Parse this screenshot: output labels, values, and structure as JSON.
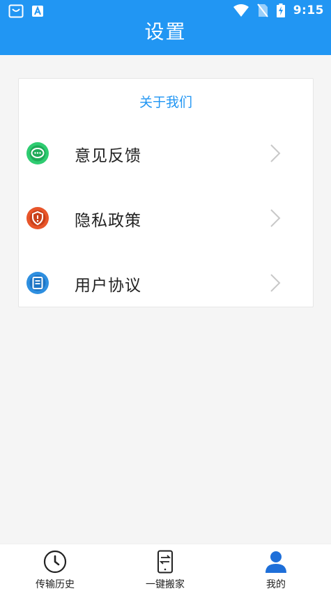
{
  "status_bar": {
    "time": "9:15",
    "left_icons": [
      "shopping-bag-icon",
      "font-a-icon"
    ],
    "right_icons": [
      "wifi-icon",
      "no-sim-icon",
      "battery-charging-icon"
    ]
  },
  "header": {
    "title": "设置"
  },
  "settings": {
    "section_title": "关于我们",
    "items": [
      {
        "label": "意见反馈",
        "icon": "feedback-icon",
        "icon_color": "#2ecc71"
      },
      {
        "label": "隐私政策",
        "icon": "privacy-shield-icon",
        "icon_color": "#e8552a"
      },
      {
        "label": "用户协议",
        "icon": "agreement-icon",
        "icon_color": "#2e8fe0"
      }
    ]
  },
  "bottom_nav": {
    "items": [
      {
        "label": "传输历史",
        "icon": "clock-icon",
        "active": false
      },
      {
        "label": "一键搬家",
        "icon": "phone-transfer-icon",
        "active": false
      },
      {
        "label": "我的",
        "icon": "user-icon",
        "active": true
      }
    ]
  },
  "colors": {
    "accent": "#2196f3",
    "background": "#f5f5f5",
    "active_nav": "#1e6fd9"
  }
}
